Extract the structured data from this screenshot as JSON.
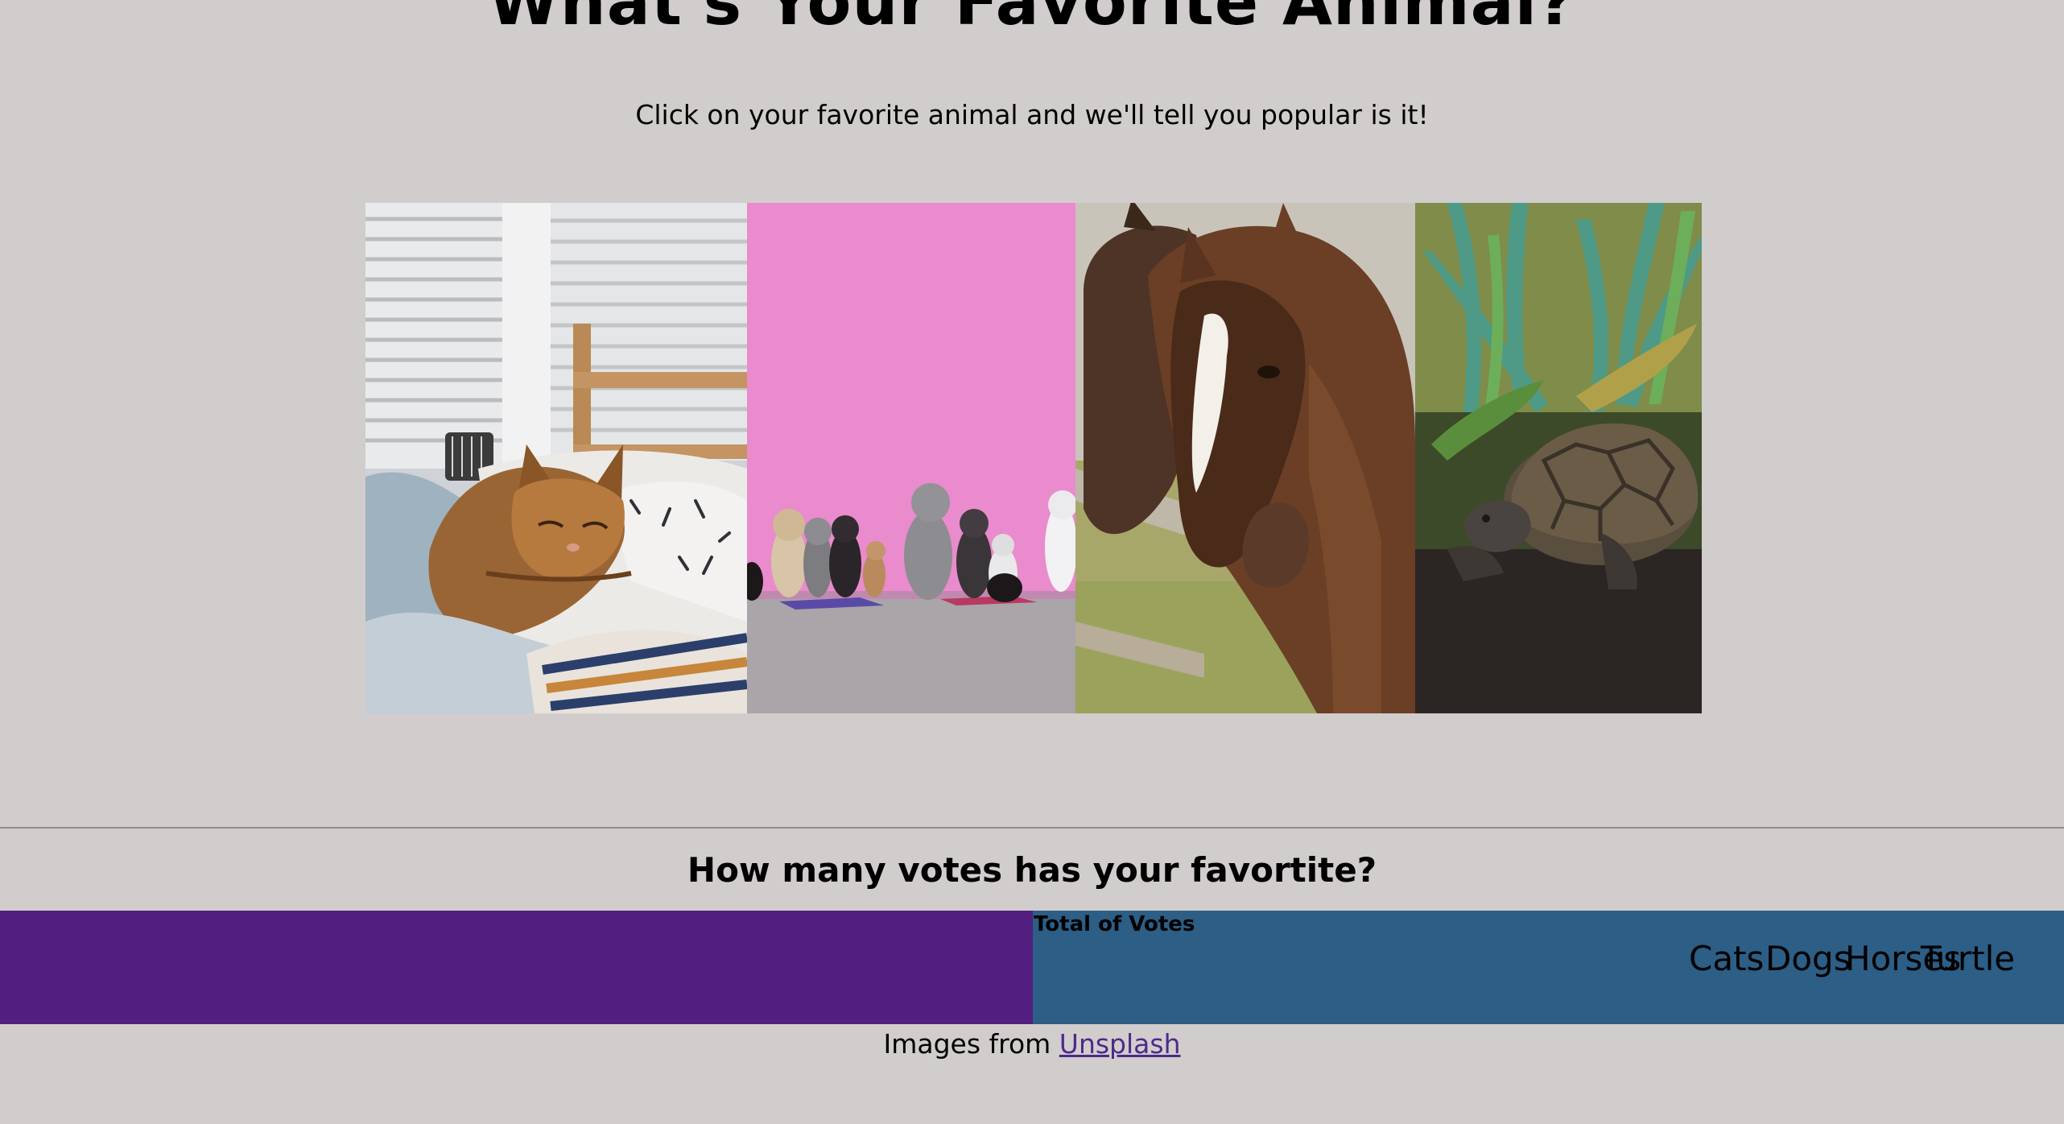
{
  "page": {
    "title": "What's Your Favorite Animal?",
    "subtitle": "Click on your favorite animal and we'll tell you popular is it!"
  },
  "gallery": {
    "photos": [
      {
        "name": "cat",
        "icon": "cat-photo"
      },
      {
        "name": "dogs",
        "icon": "dogs-photo"
      },
      {
        "name": "horse",
        "icon": "horse-photo"
      },
      {
        "name": "turtle",
        "icon": "turtle-photo"
      }
    ]
  },
  "votes": {
    "heading": "How many votes has your favortite?"
  },
  "chart_data": {
    "type": "bar",
    "title": "Total of Votes",
    "categories": [
      "Cats",
      "Dogs",
      "Horses",
      "Turtle"
    ],
    "colors": {
      "left_panel": "#521f80",
      "right_panel": "#2c5e86"
    }
  },
  "footer": {
    "prefix": "Images from ",
    "link_label": "Unsplash"
  },
  "colors": {
    "background": "#d1cdcc",
    "link": "#4d2a8a"
  }
}
